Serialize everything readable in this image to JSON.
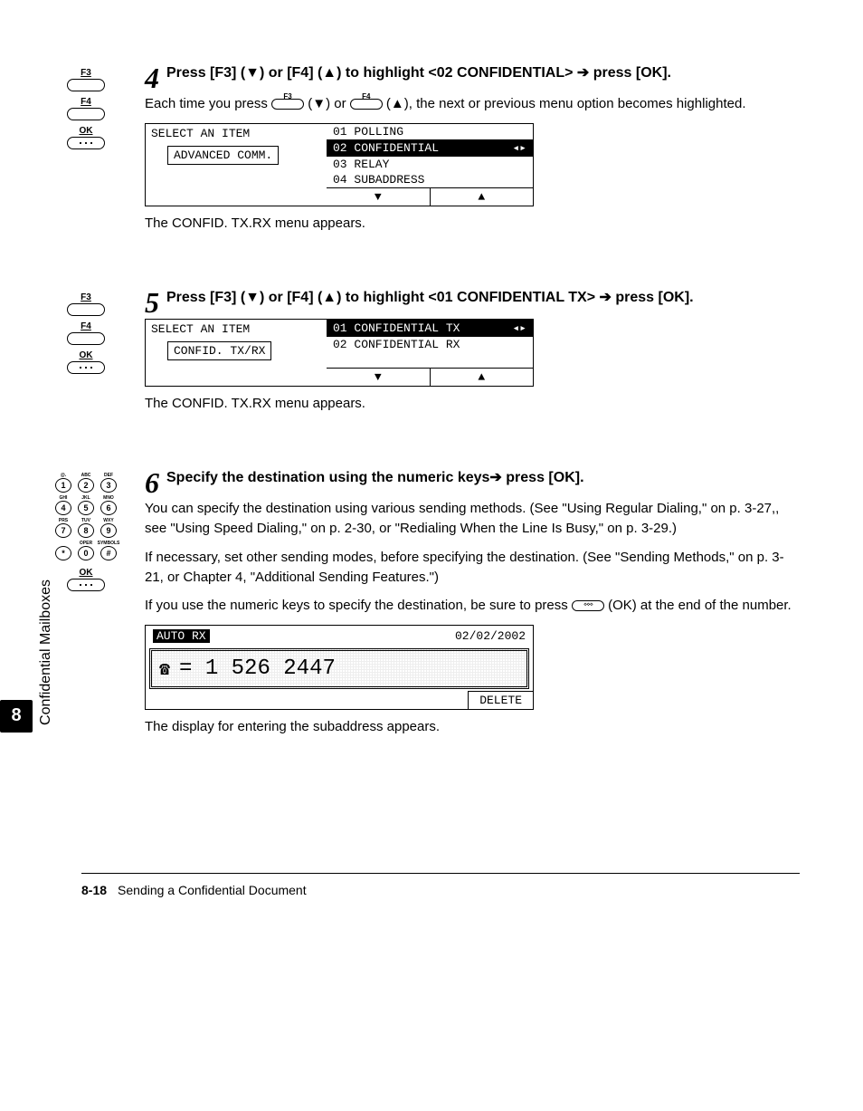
{
  "page": {
    "chapter_num": "8",
    "chapter_label": "Confidential Mailboxes",
    "page_num": "8-18",
    "footer_title": "Sending a Confidential Document"
  },
  "step4": {
    "num": "4",
    "title_a": "Press [F3] (▼) or [F4] (▲) to highlight <02 CONFIDENTIAL> ➔ press [OK].",
    "body_a": "Each time you press ",
    "body_b": " (▼) or ",
    "body_c": " (▲), the next or previous menu option becomes highlighted.",
    "after": "The CONFID. TX.RX menu appears.",
    "lcd_prompt": "SELECT AN ITEM",
    "lcd_breadcrumb": "ADVANCED COMM.",
    "opts": [
      "01 POLLING",
      "02 CONFIDENTIAL",
      "03 RELAY",
      "04 SUBADDRESS"
    ]
  },
  "step5": {
    "num": "5",
    "title": "Press [F3] (▼) or [F4] (▲) to highlight <01 CONFIDENTIAL TX> ➔ press [OK].",
    "after": "The CONFID. TX.RX menu appears.",
    "lcd_prompt": "SELECT AN ITEM",
    "lcd_breadcrumb": "CONFID. TX/RX",
    "opts": [
      "01 CONFIDENTIAL TX",
      "02 CONFIDENTIAL RX"
    ]
  },
  "step6": {
    "num": "6",
    "title": "Specify the destination using the numeric keys➔ press [OK].",
    "p1": "You can specify the destination using various sending methods. (See \"Using Regular Dialing,\" on p. 3-27,, see \"Using Speed Dialing,\" on p. 2-30, or \"Redialing When the Line Is Busy,\" on p. 3-29.)",
    "p2": "If necessary, set other sending modes, before specifying the destination. (See \"Sending Methods,\" on p. 3-21, or Chapter 4, \"Additional Sending Features.\")",
    "p3a": "If you use the numeric keys to specify the destination, be sure to press ",
    "p3b": " (OK) at the end of the number.",
    "after": "The display for entering the subaddress appears.",
    "lcd_mode": "AUTO RX",
    "lcd_date": "02/02/2002",
    "lcd_number": "= 1  526 2447",
    "lcd_delete": "DELETE"
  },
  "buttons": {
    "f3": "F3",
    "f4": "F4",
    "ok": "OK"
  },
  "keypad": {
    "labels": [
      "@.",
      "ABC",
      "DEF",
      "GHI",
      "JKL",
      "MNO",
      "PRS",
      "TUV",
      "WXY",
      "",
      "OPER",
      "SYMBOLS"
    ],
    "keys": [
      "1",
      "2",
      "3",
      "4",
      "5",
      "6",
      "7",
      "8",
      "9",
      "*",
      "0",
      "#"
    ]
  },
  "arrows": {
    "down": "▼",
    "up": "▲",
    "updown": "▲▼"
  }
}
